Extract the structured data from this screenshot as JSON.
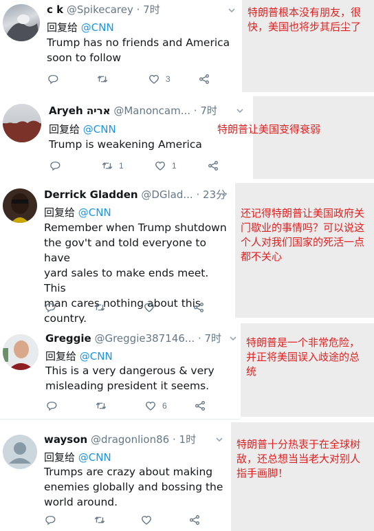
{
  "tweets": [
    {
      "name": "c k",
      "handle": "@Spikecarey",
      "time": "· 7时",
      "reply_label": "回复给",
      "reply_to": "@CNN",
      "text": "Trump has no friends and America\nsoon to follow",
      "retweets": "",
      "likes": "3",
      "note": "特朗普根本没有朋友，很快，美国也将步其后尘了"
    },
    {
      "name": "Aryeh אריה",
      "handle": "@Manoncam...",
      "time": "· 7时",
      "reply_label": "回复给",
      "reply_to": "@CNN",
      "text": "Trump is weakening America",
      "retweets": "1",
      "likes": "1",
      "note": "特朗普让美国变得衰弱"
    },
    {
      "name": "Derrick Gladden",
      "handle": "@DGlad...",
      "time": "· 23分",
      "reply_label": "回复给",
      "reply_to": "@CNN",
      "text": "Remember when Trump shutdown\nthe gov't and told everyone to have\nyard sales to make ends meet.  This\nman cares nothing about this\ncountry.",
      "retweets": "",
      "likes": "",
      "note": "还记得特朗普让美国政府关门歇业的事情吗？可以说这个人对我们国家的死活一点都不关心"
    },
    {
      "name": "Greggie",
      "handle": "@Greggie387146...",
      "time": "· 7时",
      "reply_label": "回复给",
      "reply_to": "@CNN",
      "text": "This is a very dangerous & very\nmisleading president it seems.",
      "retweets": "",
      "likes": "6",
      "note": "特朗普是一个非常危险，并正将美国误入歧途的总统"
    },
    {
      "name": "wayson",
      "handle": "@dragonlion86",
      "time": "· 1时",
      "reply_label": "回复给",
      "reply_to": "@CNN",
      "text": "Trumps are crazy about making\nenemies globally and bossing the\nworld around.",
      "retweets": "",
      "likes": "",
      "note": "特朗普十分热衷于在全球树敌，还总想当当老大对别人指手画脚！"
    }
  ],
  "icons": {
    "reply": "reply-icon",
    "retweet": "retweet-icon",
    "like": "heart-icon",
    "share": "share-icon",
    "menu": "chevron-down-icon"
  },
  "colors": {
    "link": "#1b95e0",
    "muted": "#657786",
    "note_text": "#e02020",
    "note_bg": "#ececec"
  }
}
